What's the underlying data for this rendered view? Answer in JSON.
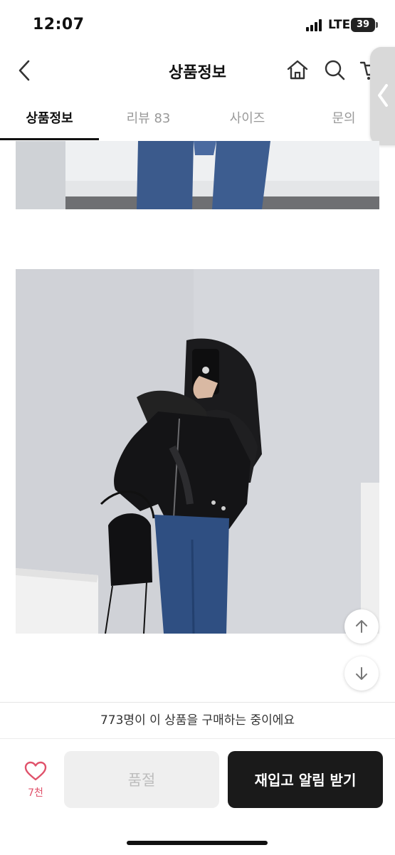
{
  "status_bar": {
    "time": "12:07",
    "network": "LTE",
    "battery": "39"
  },
  "header": {
    "title": "상품정보"
  },
  "tabs": [
    {
      "label": "상품정보",
      "active": true
    },
    {
      "label": "리뷰 83",
      "active": false
    },
    {
      "label": "사이즈",
      "active": false
    },
    {
      "label": "문의",
      "active": false
    }
  ],
  "purchase_notice": "773명이 이 상품을 구매하는 중이에요",
  "like": {
    "count": "7천"
  },
  "buttons": {
    "soldout_label": "품절",
    "restock_label": "재입고 알림 받기"
  },
  "colors": {
    "accent_pink": "#e0526b",
    "dark_button": "#1a1a1a"
  }
}
